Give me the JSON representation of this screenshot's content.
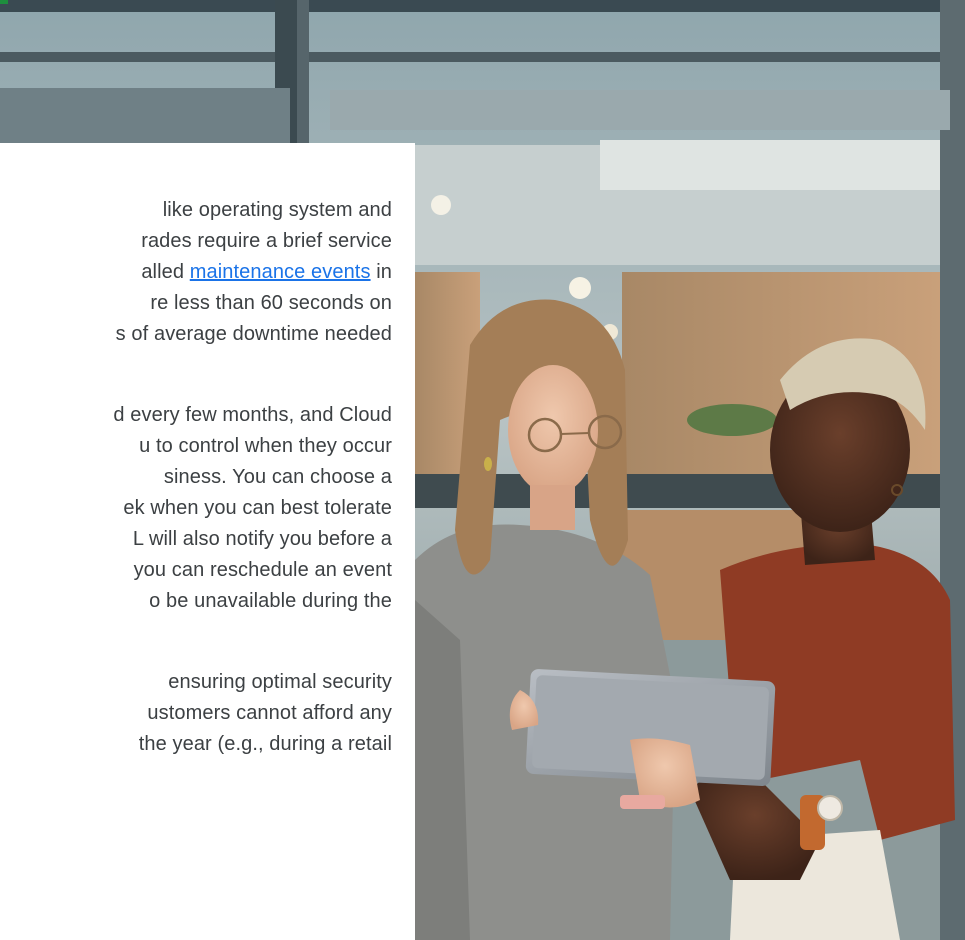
{
  "accent_color": "#1e8e3e",
  "link_color": "#1a73e8",
  "text_color": "#3c4043",
  "photo": {
    "description_icon": "photo-two-women-tablet"
  },
  "paragraphs": [
    {
      "lines": [
        {
          "text": "like operating system and"
        },
        {
          "text": "rades require a brief service"
        },
        {
          "pre": "alled ",
          "link": "maintenance events",
          "post": " in"
        },
        {
          "text": "re less than 60 seconds on"
        },
        {
          "text": "s of average downtime needed"
        }
      ]
    },
    {
      "lines": [
        {
          "text": "d every few months, and Cloud"
        },
        {
          "text": "u to control when they occur"
        },
        {
          "text": "siness. You can choose a"
        },
        {
          "text": "ek when you can best tolerate"
        },
        {
          "text": "L will also notify you before a"
        },
        {
          "text": "you can reschedule an event"
        },
        {
          "text": "o be unavailable during the"
        }
      ]
    },
    {
      "lines": [
        {
          "text": "ensuring optimal security"
        },
        {
          "text": "ustomers cannot afford any"
        },
        {
          "text": "the year (e.g., during a retail"
        }
      ]
    }
  ]
}
